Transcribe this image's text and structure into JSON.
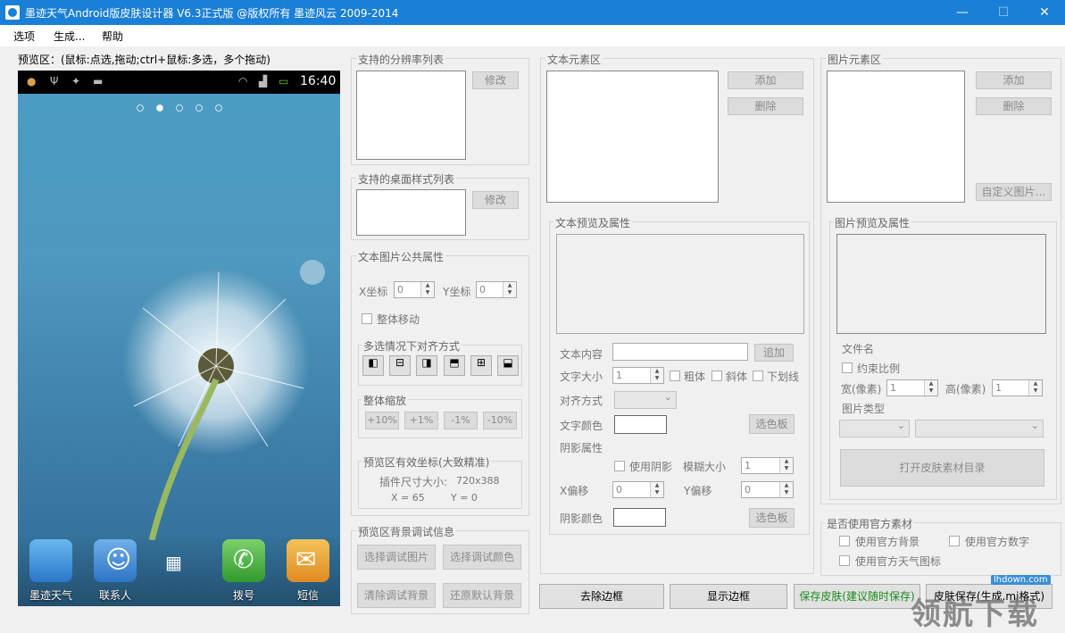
{
  "window": {
    "title": "墨迹天气Android版皮肤设计器 V6.3正式版 @版权所有 墨迹风云 2009-2014",
    "min": "—",
    "max": "☐",
    "close": "✕"
  },
  "menu": [
    "选项",
    "生成...",
    "帮助"
  ],
  "preview": {
    "label": "预览区：(鼠标:点选,拖动;ctrl+鼠标:多选，多个拖动)",
    "time": "16:40",
    "apps": [
      {
        "label": "墨迹天气",
        "color": "#3a8fd8"
      },
      {
        "label": "联系人",
        "color": "#3e8ed1"
      },
      {
        "label": "",
        "color": "#e6e6e6"
      },
      {
        "label": "拨号",
        "color": "#3aa73a"
      },
      {
        "label": "短信",
        "color": "#e8a030"
      }
    ]
  },
  "resolution": {
    "title": "支持的分辨率列表",
    "btn": "修改"
  },
  "desktop": {
    "title": "支持的桌面样式列表",
    "btn": "修改"
  },
  "common": {
    "title": "文本图片公共属性",
    "xlabel": "X坐标",
    "xval": "0",
    "ylabel": "Y坐标",
    "yval": "0",
    "move": "整体移动",
    "align_title": "多选情况下对齐方式",
    "zoom_title": "整体缩放",
    "zoom": [
      "+10%",
      "+1%",
      "-1%",
      "-10%"
    ],
    "coord_title": "预览区有效坐标(大致精准)",
    "plugin": "插件尺寸大小:",
    "size": "720x388",
    "x": "X = 65",
    "y": "Y = 0"
  },
  "bg": {
    "title": "预览区背景调试信息",
    "b1": "选择调试图片",
    "b2": "选择调试颜色",
    "b3": "清除调试背景",
    "b4": "还原默认背景"
  },
  "text": {
    "title": "文本元素区",
    "add": "添加",
    "del": "删除",
    "props": "文本预览及属性",
    "content": "文本内容",
    "add2": "追加",
    "size": "文字大小",
    "sizeval": "1",
    "bold": "粗体",
    "italic": "斜体",
    "underline": "下划线",
    "align": "对齐方式",
    "color": "文字颜色",
    "palette": "选色板",
    "shadow": "阴影属性",
    "useshadow": "使用阴影",
    "blur": "模糊大小",
    "blurval": "1",
    "xoff": "X偏移",
    "xoffval": "0",
    "yoff": "Y偏移",
    "yoffval": "0",
    "scolor": "阴影颜色",
    "palette2": "选色板"
  },
  "image": {
    "title": "图片元素区",
    "add": "添加",
    "del": "删除",
    "custom": "自定义图片…",
    "props": "图片预览及属性",
    "filename": "文件名",
    "ratio": "约束比例",
    "w": "宽(像素)",
    "wval": "1",
    "h": "高(像素)",
    "hval": "1",
    "type": "图片类型",
    "open": "打开皮肤素材目录"
  },
  "official": {
    "title": "是否使用官方素材",
    "bg": "使用官方背景",
    "num": "使用官方数字",
    "icon": "使用官方天气图标"
  },
  "bottom": {
    "remove": "去除边框",
    "show": "显示边框",
    "save": "保存皮肤(建议随时保存)",
    "save2": "皮肤保存(生成.mj格式)"
  },
  "watermark": {
    "site": "lhdown.com",
    "text": "领航下载"
  }
}
